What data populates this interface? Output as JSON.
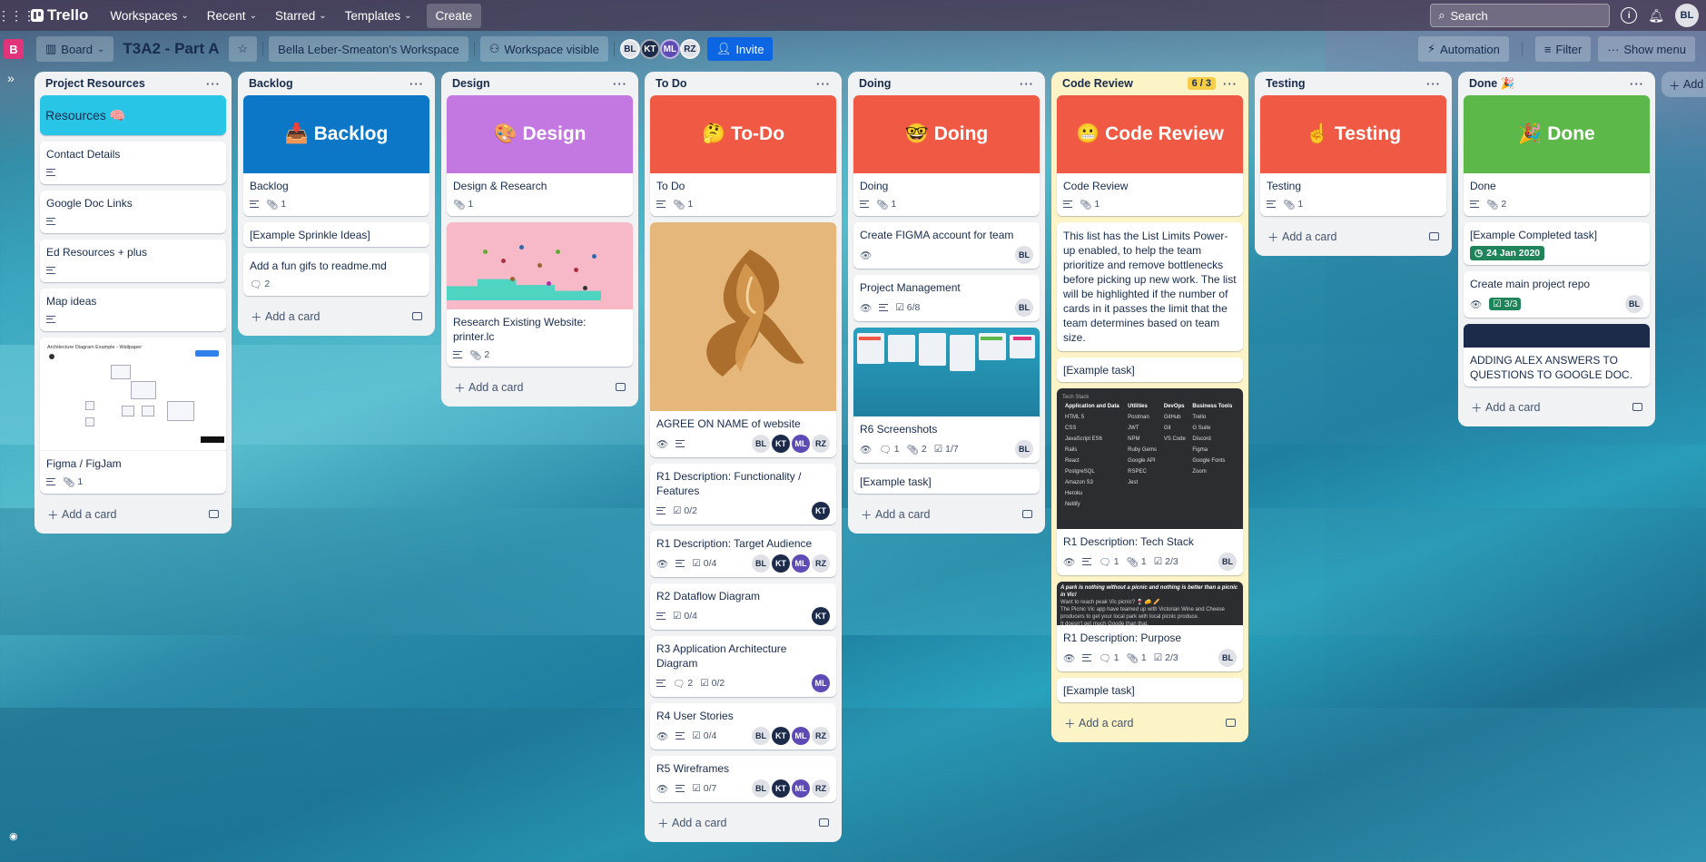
{
  "topnav": {
    "logo": "Trello",
    "menus": [
      "Workspaces",
      "Recent",
      "Starred",
      "Templates"
    ],
    "create": "Create",
    "search_placeholder": "Search",
    "me_initials": "BL"
  },
  "board": {
    "view": "Board",
    "title": "T3A2 - Part A",
    "workspace": "Bella Leber-Smeaton's Workspace",
    "visibility": "Workspace visible",
    "members": [
      "BL",
      "KT",
      "ML",
      "RZ"
    ],
    "invite": "Invite",
    "automation": "Automation",
    "filter": "Filter",
    "show_menu": "Show menu",
    "workspace_initial": "B"
  },
  "add_card": "Add a card",
  "add_list": "Add",
  "lists": {
    "resources": {
      "name": "Project Resources",
      "cards": {
        "r0": "Resources 🧠",
        "r1": "Contact Details",
        "r2": "Google Doc Links",
        "r3": "Ed Resources + plus",
        "r4": "Map ideas",
        "r5": "Figma / FigJam",
        "r5_attach": "1",
        "thumb_title": "Architecture Diagram Example - Wallpaper"
      }
    },
    "backlog": {
      "name": "Backlog",
      "cover": "📥 Backlog",
      "cards": {
        "c0": "Backlog",
        "c0_attach": "1",
        "c1": "[Example Sprinkle Ideas]",
        "c2": "Add a fun gifs to readme.md",
        "c2_comments": "2"
      }
    },
    "design": {
      "name": "Design",
      "cover": "🎨 Design",
      "cards": {
        "c0": "Design & Research",
        "c0_attach": "1",
        "c1": "Research Existing Website: printer.lc",
        "c1_attach": "2"
      }
    },
    "todo": {
      "name": "To Do",
      "cover": "🤔 To-Do",
      "cards": {
        "c0": "To Do",
        "c0_attach": "1",
        "c1": "AGREE ON NAME of website",
        "c2": "R1 Description: Functionality / Features",
        "c2_check": "0/2",
        "c3": "R1 Description: Target Audience",
        "c3_check": "0/4",
        "c4": "R2 Dataflow Diagram",
        "c4_check": "0/4",
        "c5": "R3 Application Architecture Diagram",
        "c5_comments": "2",
        "c5_check": "0/2",
        "c6": "R4 User Stories",
        "c6_check": "0/4",
        "c7": "R5 Wireframes",
        "c7_check": "0/7"
      }
    },
    "doing": {
      "name": "Doing",
      "cover": "🤓 Doing",
      "cards": {
        "c0": "Doing",
        "c0_attach": "1",
        "c1": "Create FIGMA account for team",
        "c2": "Project Management",
        "c2_check": "6/8",
        "c3": "R6 Screenshots",
        "c3_comments": "1",
        "c3_attach": "2",
        "c3_check": "1/7",
        "c4": "[Example task]"
      }
    },
    "review": {
      "name": "Code Review",
      "limit": "6 / 3",
      "cover": "😬 Code Review",
      "cards": {
        "c0": "Code Review",
        "c0_attach": "1",
        "c1": "This list has the List Limits Power-up enabled, to help the team prioritize and remove bottlenecks before picking up new work. The list will be highlighted if the number of cards in it passes the limit that the team determines based on team size.",
        "c2": "[Example task]",
        "c3": "R1 Description: Tech Stack",
        "c3_comments": "1",
        "c3_attach": "1",
        "c3_check": "2/3",
        "c4": "R1 Description: Purpose",
        "c4_comments": "1",
        "c4_attach": "1",
        "c4_check": "2/3",
        "c5": "[Example task]",
        "purpose_thumb_head": "A park is nothing without a picnic and nothing is better than a picnic in Vic!",
        "purpose_thumb_l1": "Want to reach peak Vic picnic? 🍷 🧀 🥖",
        "purpose_thumb_l2": "The Picnic Vic app have teamed up with Victorian Wine and Cheese producers to get your local park with local picnic produce.",
        "purpose_thumb_l3": "It doesn't get much Goode than that.",
        "stack_table": [
          [
            "Application and Data",
            "Utilities",
            "DevOps",
            "Business Tools"
          ],
          [
            "HTML 5",
            "Postman",
            "GitHub",
            "Trello"
          ],
          [
            "CSS",
            "JWT",
            "Git",
            "G Suite"
          ],
          [
            "JavaScript ES6",
            "NPM",
            "VS Code",
            "Discord"
          ],
          [
            "Rails",
            "Ruby Gems",
            "",
            "Figma"
          ],
          [
            "React",
            "Google API",
            "",
            "Google Fonts"
          ],
          [
            "PostgreSQL",
            "RSPEC",
            "",
            "Zoom"
          ],
          [
            "Amazon S3",
            "Jest",
            "",
            ""
          ],
          [
            "Heroku",
            "",
            "",
            ""
          ],
          [
            "Netlify",
            "",
            "",
            ""
          ]
        ],
        "stack_caption": "Tech Stack"
      }
    },
    "testing": {
      "name": "Testing",
      "cover": "☝️ Testing",
      "cards": {
        "c0": "Testing",
        "c0_attach": "1"
      }
    },
    "done": {
      "name": "Done 🎉",
      "cover": "🎉 Done",
      "cards": {
        "c0": "Done",
        "c0_attach": "2",
        "c1": "[Example Completed task]",
        "c1_date": "24 Jan 2020",
        "c2": "Create main project repo",
        "c2_check": "3/3",
        "c3": "ADDING ALEX ANSWERS TO QUESTIONS TO GOOGLE DOC."
      }
    }
  },
  "colors": {
    "cover_cyan": "#29c5e6",
    "cover_blue": "#0c77c7",
    "cover_purple": "#c377e0",
    "cover_red": "#f05a45",
    "cover_green": "#5db84a",
    "limit_yellow": "#f5cd47",
    "invite_blue": "#0c66e4"
  }
}
